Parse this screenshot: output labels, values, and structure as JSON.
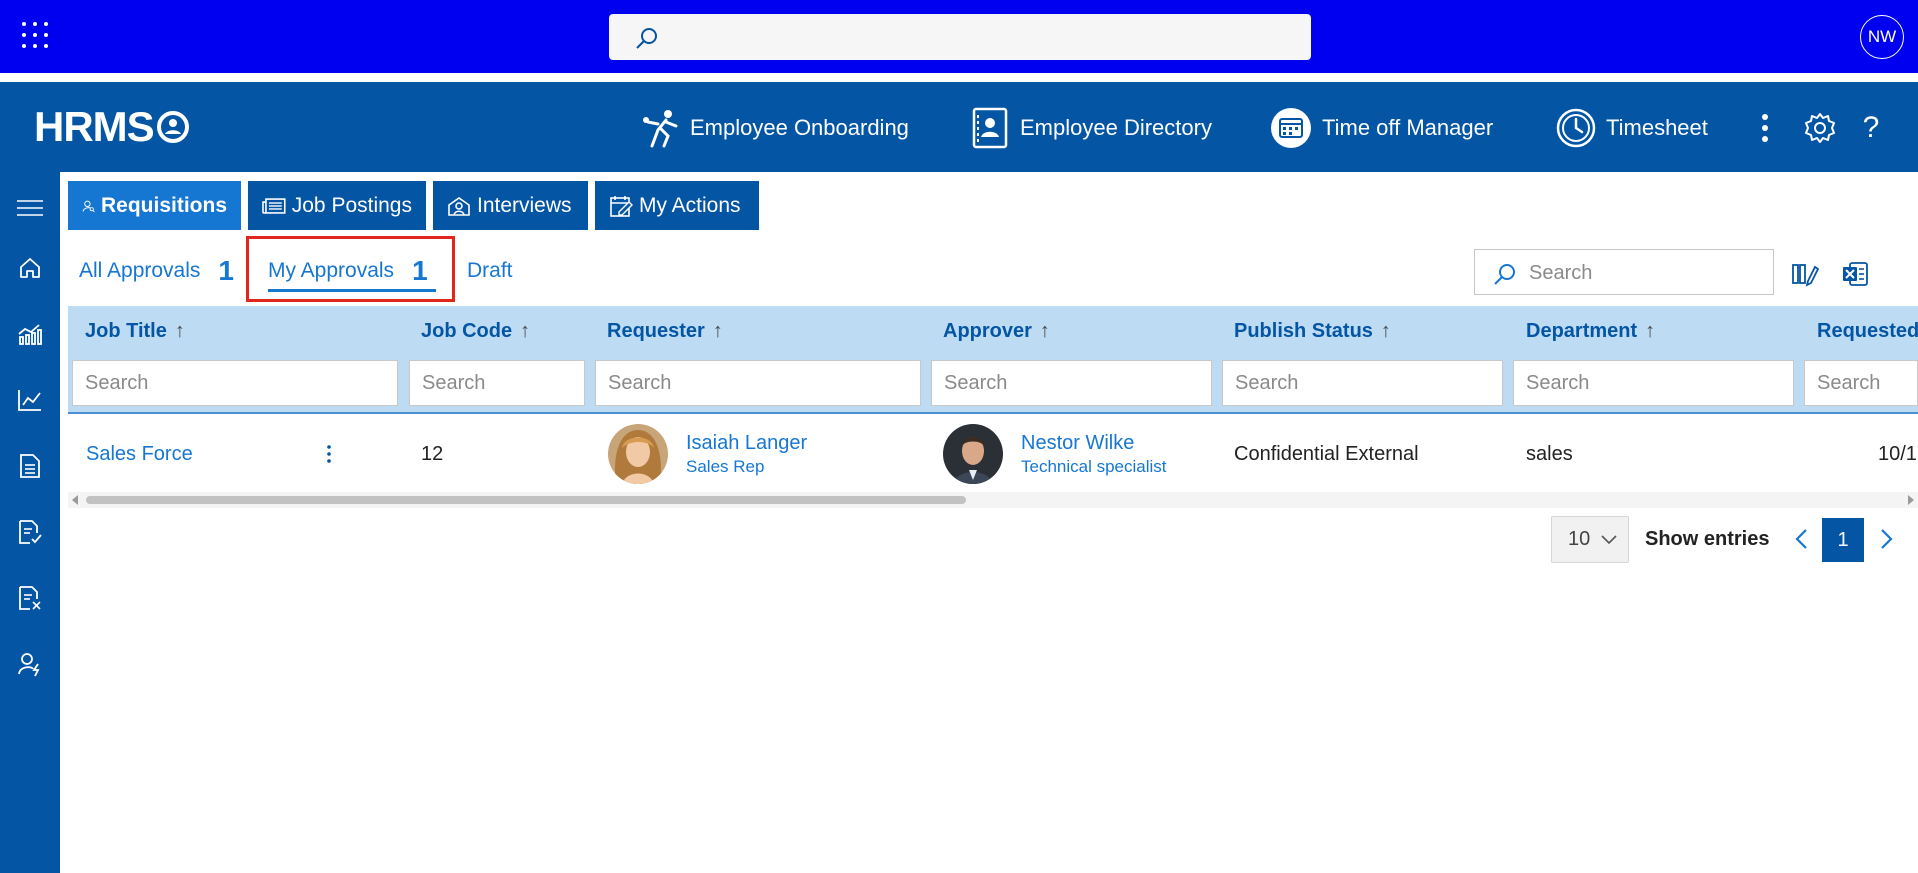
{
  "suite": {
    "avatar_initials": "NW",
    "icons": [
      "app-launcher-icon",
      "search-icon"
    ]
  },
  "header": {
    "logo": "HRMS",
    "nav": [
      {
        "label": "Employee Onboarding",
        "icon": "onboarding-icon"
      },
      {
        "label": "Employee Directory",
        "icon": "directory-icon"
      },
      {
        "label": "Time off Manager",
        "icon": "calendar-icon"
      },
      {
        "label": "Timesheet",
        "icon": "clock-icon"
      }
    ],
    "actions": [
      "more-vertical-icon",
      "gear-icon",
      "help-icon"
    ]
  },
  "rail": {
    "items": [
      "hamburger-icon",
      "home-icon",
      "analytics-icon",
      "line-chart-icon",
      "document-icon",
      "document-check-icon",
      "document-x-icon",
      "user-flash-icon"
    ]
  },
  "module_tabs": [
    {
      "label": "Requisitions",
      "active": true
    },
    {
      "label": "Job Postings",
      "active": false
    },
    {
      "label": "Interviews",
      "active": false
    },
    {
      "label": "My Actions",
      "active": false
    }
  ],
  "sub_tabs": {
    "all": {
      "label": "All Approvals",
      "count": "1"
    },
    "mine": {
      "label": "My Approvals",
      "count": "1",
      "active": true
    },
    "draft": {
      "label": "Draft"
    }
  },
  "table_search": {
    "placeholder": "Search"
  },
  "grid": {
    "sort_glyph": "↑",
    "filter_placeholder": "Search",
    "columns": [
      {
        "title": "Job Title"
      },
      {
        "title": "Job Code"
      },
      {
        "title": "Requester"
      },
      {
        "title": "Approver"
      },
      {
        "title": "Publish Status"
      },
      {
        "title": "Department"
      },
      {
        "title": "Requested"
      }
    ],
    "rows": [
      {
        "job_title": "Sales Force",
        "job_code": "12",
        "requester": {
          "name": "Isaiah Langer",
          "role": "Sales Rep"
        },
        "approver": {
          "name": "Nestor Wilke",
          "role": "Technical specialist"
        },
        "publish_status": "Confidential External",
        "department": "sales",
        "requested": "10/1"
      }
    ]
  },
  "pager": {
    "page_size": "10",
    "show_entries": "Show entries",
    "current_page": "1"
  },
  "colors": {
    "suite_bar": "#0000f0",
    "app_bar": "#0455a4",
    "accent": "#1677d3",
    "grid_header": "#bddcf4",
    "highlight": "#e1261c"
  }
}
